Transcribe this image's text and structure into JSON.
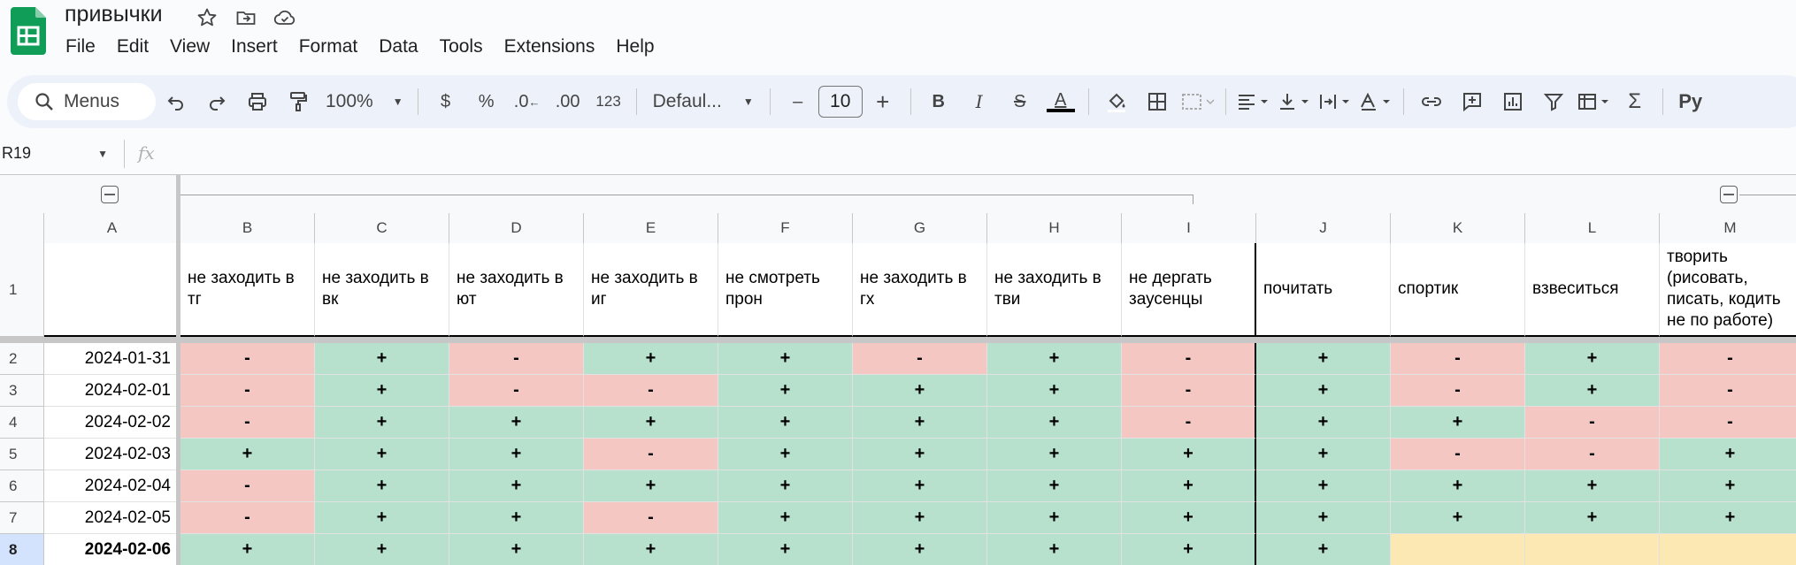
{
  "doc": {
    "title": "привычки"
  },
  "menu": [
    "File",
    "Edit",
    "View",
    "Insert",
    "Format",
    "Data",
    "Tools",
    "Extensions",
    "Help"
  ],
  "toolbar": {
    "search_label": "Menus",
    "zoom": "100%",
    "currency": "$",
    "percent": "%",
    "dec_decrease": ".0",
    "dec_increase": ".00",
    "number_format": "123",
    "font": "Defaul...",
    "font_size": "10",
    "minus": "–",
    "plus": "+",
    "bold": "B",
    "italic": "I",
    "strike": "S",
    "text_color": "A",
    "script_btn": "Ру"
  },
  "formula_bar": {
    "name_box": "R19",
    "fx": "fx"
  },
  "columns": [
    "A",
    "B",
    "C",
    "D",
    "E",
    "F",
    "G",
    "H",
    "I",
    "J",
    "K",
    "L",
    "M"
  ],
  "headers": [
    "",
    "не заходить в тг",
    "не заходить в вк",
    "не заходить в ют",
    "не заходить в иг",
    "не смотреть прон",
    "не заходить в гх",
    "не заходить в тви",
    "не дергать заусенцы",
    "почитать",
    "спортик",
    "взвеситься",
    "творить (рисовать, писать, кодить не по работе)"
  ],
  "rows": [
    {
      "num": "1"
    },
    {
      "num": "2",
      "date": "2024-01-31",
      "marks": [
        "-",
        "+",
        "-",
        "+",
        "+",
        "-",
        "+",
        "-",
        "+",
        "-",
        "+",
        "-"
      ]
    },
    {
      "num": "3",
      "date": "2024-02-01",
      "marks": [
        "-",
        "+",
        "-",
        "-",
        "+",
        "+",
        "+",
        "-",
        "+",
        "-",
        "+",
        "-"
      ]
    },
    {
      "num": "4",
      "date": "2024-02-02",
      "marks": [
        "-",
        "+",
        "+",
        "+",
        "+",
        "+",
        "+",
        "-",
        "+",
        "+",
        "-",
        "-"
      ]
    },
    {
      "num": "5",
      "date": "2024-02-03",
      "marks": [
        "+",
        "+",
        "+",
        "-",
        "+",
        "+",
        "+",
        "+",
        "+",
        "-",
        "-",
        "+"
      ]
    },
    {
      "num": "6",
      "date": "2024-02-04",
      "marks": [
        "-",
        "+",
        "+",
        "+",
        "+",
        "+",
        "+",
        "+",
        "+",
        "+",
        "+",
        "+"
      ]
    },
    {
      "num": "7",
      "date": "2024-02-05",
      "marks": [
        "-",
        "+",
        "+",
        "-",
        "+",
        "+",
        "+",
        "+",
        "+",
        "+",
        "+",
        "+"
      ]
    },
    {
      "num": "8",
      "date": "2024-02-06",
      "marks": [
        "+",
        "+",
        "+",
        "+",
        "+",
        "+",
        "+",
        "+",
        "+",
        "",
        "",
        ""
      ]
    }
  ],
  "colors": {
    "plus": "#b7e1cd",
    "minus": "#f4c7c3",
    "empty": "#fce8b2",
    "selected_row": "#d3e3fd"
  }
}
